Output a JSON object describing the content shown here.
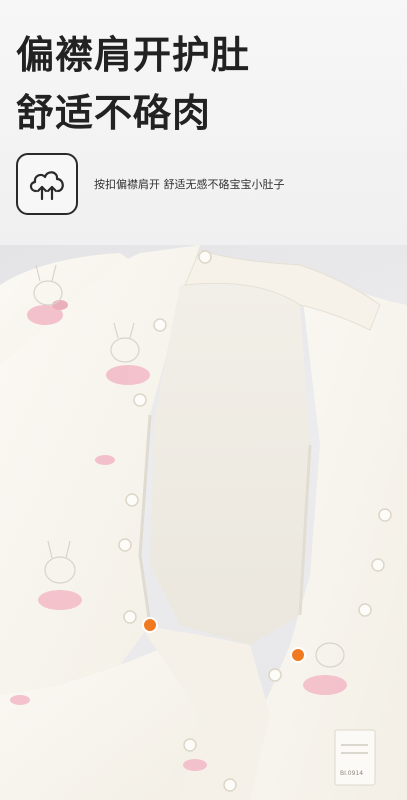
{
  "headline": {
    "line1": "偏襟肩开护肚",
    "line2": "舒适不硌肉"
  },
  "feature": {
    "icon": "cloud-arrows-icon",
    "text": "按扣偏襟肩开 舒适无感不硌宝宝小肚子"
  },
  "product": {
    "description": "white baby romper with pink bunny ballerina print, snap buttons",
    "label_text": "BI.0914"
  },
  "colors": {
    "fabric": "#f8f5ee",
    "print_pink": "#f2b8c6",
    "snap_orange": "#f07a1f",
    "text_dark": "#222222"
  }
}
